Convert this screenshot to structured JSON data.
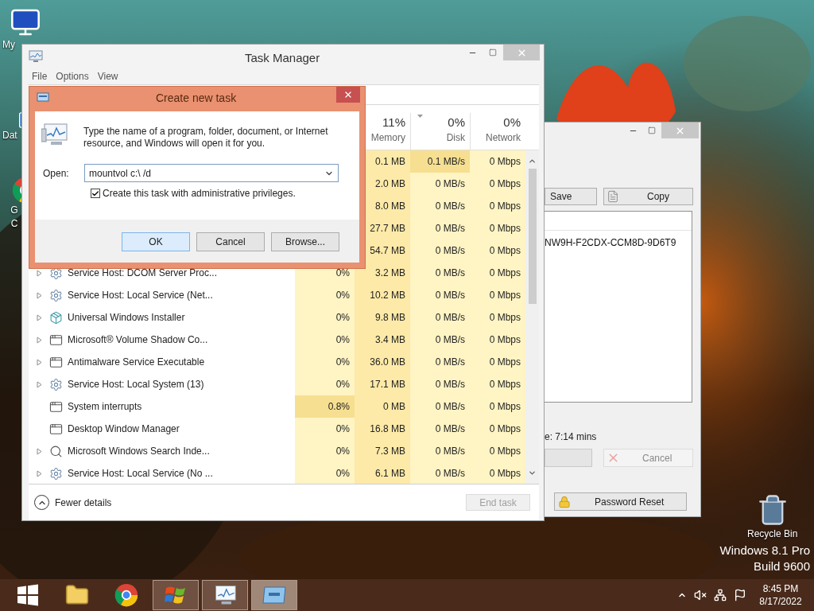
{
  "desktop_icons": [
    {
      "kind": "computer",
      "label": "My"
    },
    {
      "kind": "shortcut",
      "label": "Dat"
    },
    {
      "kind": "browser",
      "label": "G C"
    }
  ],
  "recycle_bin": {
    "label": "Recycle Bin"
  },
  "os_info": {
    "edition": "Windows 8.1 Pro",
    "build": "Build 9600"
  },
  "task_manager": {
    "title": "Task Manager",
    "menu": [
      "File",
      "Options",
      "View"
    ],
    "columns": [
      {
        "percent": "11%",
        "label": "Memory",
        "sorted": false
      },
      {
        "percent": "0%",
        "label": "Disk",
        "sorted": true
      },
      {
        "percent": "0%",
        "label": "Network",
        "sorted": false
      }
    ],
    "rows": [
      {
        "memory": "0.1 MB",
        "disk": "0.1 MB/s",
        "network": "0 Mbps",
        "disk_busy": true
      },
      {
        "memory": "2.0 MB",
        "disk": "0 MB/s",
        "network": "0 Mbps",
        "disk_busy": false
      },
      {
        "memory": "8.0 MB",
        "disk": "0 MB/s",
        "network": "0 Mbps",
        "disk_busy": false
      },
      {
        "memory": "27.7 MB",
        "disk": "0 MB/s",
        "network": "0 Mbps",
        "disk_busy": false
      },
      {
        "memory": "54.7 MB",
        "disk": "0 MB/s",
        "network": "0 Mbps",
        "disk_busy": false
      },
      {
        "name": "Service Host: DCOM Server Proc...",
        "kind": "gear",
        "expandable": true,
        "cpu": "0%",
        "memory": "3.2 MB",
        "disk": "0 MB/s",
        "network": "0 Mbps"
      },
      {
        "name": "Service Host: Local Service (Net...",
        "kind": "gear",
        "expandable": true,
        "cpu": "0%",
        "memory": "10.2 MB",
        "disk": "0 MB/s",
        "network": "0 Mbps"
      },
      {
        "name": "Universal Windows Installer",
        "kind": "installer",
        "expandable": true,
        "cpu": "0%",
        "memory": "9.8 MB",
        "disk": "0 MB/s",
        "network": "0 Mbps"
      },
      {
        "name": "Microsoft® Volume Shadow Co...",
        "kind": "app",
        "expandable": true,
        "cpu": "0%",
        "memory": "3.4 MB",
        "disk": "0 MB/s",
        "network": "0 Mbps"
      },
      {
        "name": "Antimalware Service Executable",
        "kind": "app",
        "expandable": true,
        "cpu": "0%",
        "memory": "36.0 MB",
        "disk": "0 MB/s",
        "network": "0 Mbps"
      },
      {
        "name": "Service Host: Local System (13)",
        "kind": "gear",
        "expandable": true,
        "cpu": "0%",
        "memory": "17.1 MB",
        "disk": "0 MB/s",
        "network": "0 Mbps"
      },
      {
        "name": "System interrupts",
        "kind": "app",
        "expandable": false,
        "cpu_busy": true,
        "cpu": "0.8%",
        "memory": "0 MB",
        "disk": "0 MB/s",
        "network": "0 Mbps"
      },
      {
        "name": "Desktop Window Manager",
        "kind": "app",
        "expandable": false,
        "cpu_busy": false,
        "cpu": "0%",
        "memory": "16.8 MB",
        "disk": "0 MB/s",
        "network": "0 Mbps"
      },
      {
        "name": "Microsoft Windows Search Inde...",
        "kind": "search",
        "expandable": true,
        "cpu": "0%",
        "memory": "7.3 MB",
        "disk": "0 MB/s",
        "network": "0 Mbps"
      },
      {
        "name": "Service Host: Local Service (No ...",
        "kind": "gear",
        "expandable": true,
        "cpu": "0%",
        "memory": "6.1 MB",
        "disk": "0 MB/s",
        "network": "0 Mbps"
      }
    ],
    "fewer_details": "Fewer details",
    "end_task": {
      "label": "End task",
      "disabled": true
    }
  },
  "dialog": {
    "title": "Create new task",
    "message": "Type the name of a program, folder, document, or Internet resource, and Windows will open it for you.",
    "open_label": "Open:",
    "open_value": "mountvol c:\\ /d",
    "admin": {
      "label": "Create this task with administrative privileges.",
      "checked": true
    },
    "buttons": [
      {
        "label": "OK",
        "default": true
      },
      {
        "label": "Cancel",
        "default": false
      },
      {
        "label": "Browse...",
        "default": false
      }
    ]
  },
  "tool_window": {
    "save": "Save",
    "copy": "Copy",
    "key_text": "NW9H-F2CDX-CCM8D-9D6T9",
    "time_text": "e: 7:14 mins",
    "cancel": {
      "label": "Cancel",
      "disabled": true
    },
    "password_reset": "Password Reset"
  },
  "taskbar": {
    "items": [
      {
        "kind": "start",
        "open": false,
        "selected": false
      },
      {
        "kind": "folder",
        "open": false,
        "selected": false
      },
      {
        "kind": "browser",
        "open": false,
        "selected": false
      },
      {
        "kind": "flag",
        "open": true,
        "selected": false
      },
      {
        "kind": "monitor",
        "open": true,
        "selected": false
      },
      {
        "kind": "window",
        "open": true,
        "selected": true
      }
    ],
    "time": "8:45 PM",
    "date": "8/17/2022"
  }
}
